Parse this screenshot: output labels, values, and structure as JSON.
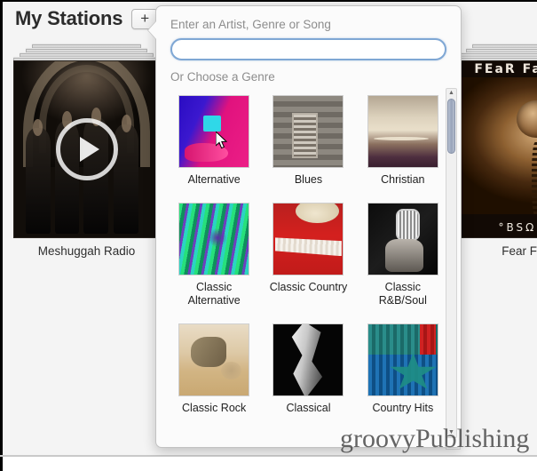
{
  "header": {
    "title": "My Stations",
    "add_button_label": "+"
  },
  "stations": [
    {
      "name": "Meshuggah Radio",
      "play_icon": "play-icon"
    },
    {
      "name": "Fear Factory",
      "album_title": "FEaR FaCTORY",
      "album_subtitle": "°BSΩLETE"
    }
  ],
  "popup": {
    "hint": "Enter an Artist, Genre or Song",
    "search_value": "",
    "search_placeholder": "",
    "subhint": "Or Choose a Genre",
    "genres": [
      {
        "label": "Alternative",
        "art": "g-alternative"
      },
      {
        "label": "Blues",
        "art": "g-blues"
      },
      {
        "label": "Christian",
        "art": "g-christian"
      },
      {
        "label": "Classic Alternative",
        "art": "g-classic-alt"
      },
      {
        "label": "Classic Country",
        "art": "g-classic-country"
      },
      {
        "label": "Classic R&B/Soul",
        "art": "g-classic-rb"
      },
      {
        "label": "Classic Rock",
        "art": "g-classic-rock"
      },
      {
        "label": "Classical",
        "art": "g-classical"
      },
      {
        "label": "Country Hits",
        "art": "g-country-hits"
      }
    ],
    "scroll_up_icon": "▲",
    "scroll_down_icon": "▼"
  },
  "page_scrollbar": {
    "up_icon": "▲"
  },
  "watermark": "groovyPublishing",
  "colors": {
    "background": "#f4f4f4",
    "popup_background": "#fbfbfb",
    "search_border": "#7fa7d4",
    "scroll_thumb": "#98a4ba",
    "title_text": "#2b2b2b",
    "hint_text": "#8d8d8d"
  }
}
